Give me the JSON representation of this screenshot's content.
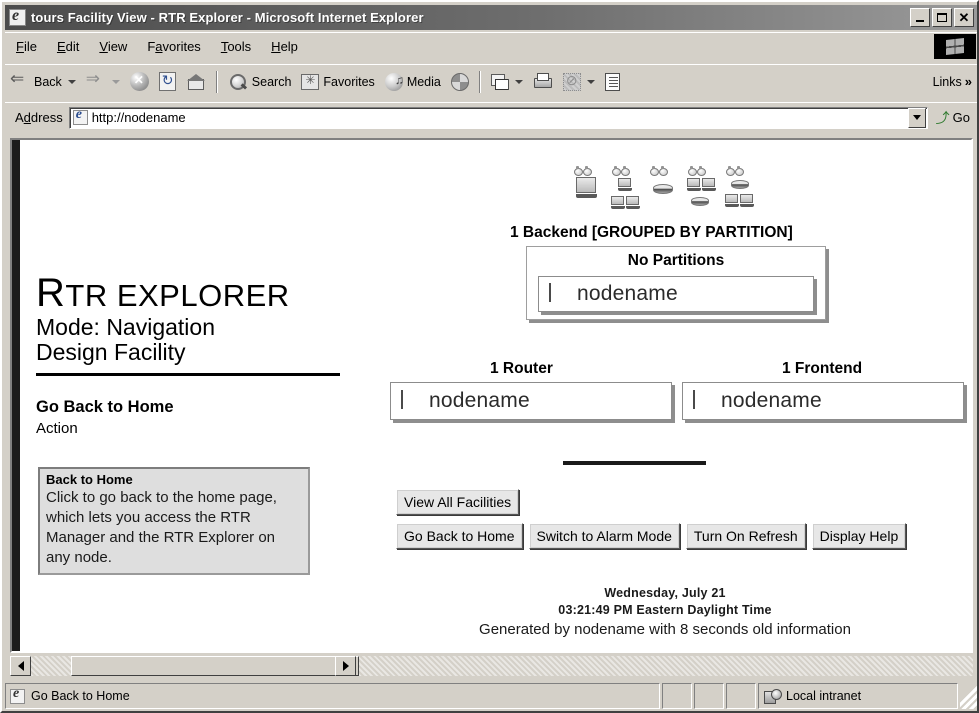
{
  "window": {
    "title": "tours Facility View - RTR Explorer - Microsoft Internet Explorer",
    "minimize_label": "_",
    "maximize_label": "",
    "close_label": "✕"
  },
  "menu": {
    "items": [
      "File",
      "Edit",
      "View",
      "Favorites",
      "Tools",
      "Help"
    ]
  },
  "toolbar": {
    "back": "Back",
    "forward": "",
    "stop": "",
    "refresh": "",
    "home": "",
    "search": "Search",
    "favorites": "Favorites",
    "media": "Media",
    "history": "",
    "mail": "",
    "print": "",
    "edit": "",
    "discuss": "",
    "links": "Links",
    "links_chevron": "»"
  },
  "address": {
    "label": "Address",
    "value": "http://nodename",
    "go_label": "Go"
  },
  "sidebar": {
    "logo_initial": "R",
    "logo_rest": "TR EXPLORER",
    "mode_line1": "Mode:  Navigation",
    "mode_line2": "Design Facility",
    "action_heading": "Go Back to Home",
    "action_label": "Action",
    "help": {
      "title": "Back to Home",
      "body": "Click to go back to the home page, which lets you access the RTR Manager and the RTR Explorer on any node."
    }
  },
  "main": {
    "backend_title": "1 Backend [GROUPED BY PARTITION]",
    "partition_title": "No Partitions",
    "partition_node": "nodename",
    "router_title": "1 Router",
    "router_node": "nodename",
    "frontend_title": "1 Frontend",
    "frontend_node": "nodename",
    "buttons_row1": [
      "View All Facilities"
    ],
    "buttons_row2": [
      "Go Back to Home",
      "Switch to Alarm Mode",
      "Turn On Refresh",
      "Display Help"
    ],
    "footer_date": "Wednesday, July 21",
    "footer_time": "03:21:49 PM Eastern Daylight Time",
    "footer_generated": "Generated by nodename with 8 seconds old information"
  },
  "statusbar": {
    "message": "Go Back to Home",
    "zone": "Local intranet"
  },
  "colors": {
    "window_face": "#d4d0c8",
    "title_gradient_start": "#4c4c4c",
    "title_gradient_end": "#9a9a9a",
    "page_background": "#ffffff",
    "text": "#000000",
    "help_box": "#dedede",
    "dark_border": "#1c1c1c"
  }
}
